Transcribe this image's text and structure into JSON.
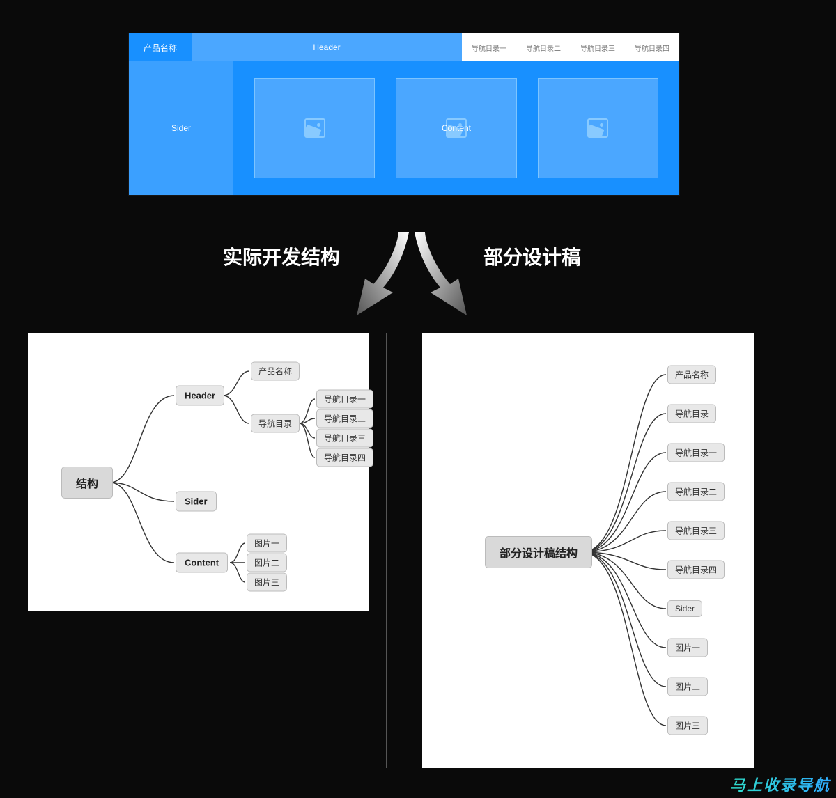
{
  "mockup": {
    "product_name": "产品名称",
    "header": "Header",
    "nav": [
      "导航目录一",
      "导航目录二",
      "导航目录三",
      "导航目录四"
    ],
    "sider": "Sider",
    "content": "Content"
  },
  "arrows": {
    "left_caption": "实际开发结构",
    "right_caption": "部分设计稿"
  },
  "left_tree": {
    "root": "结构",
    "header": "Header",
    "header_children": {
      "product_name": "产品名称",
      "nav_root": "导航目录",
      "nav_items": [
        "导航目录一",
        "导航目录二",
        "导航目录三",
        "导航目录四"
      ]
    },
    "sider": "Sider",
    "content": "Content",
    "content_items": [
      "图片一",
      "图片二",
      "图片三"
    ]
  },
  "right_tree": {
    "root": "部分设计稿结构",
    "items": [
      "产品名称",
      "导航目录",
      "导航目录一",
      "导航目录二",
      "导航目录三",
      "导航目录四",
      "Sider",
      "图片一",
      "图片二",
      "图片三"
    ]
  },
  "watermark": "马上收录导航"
}
